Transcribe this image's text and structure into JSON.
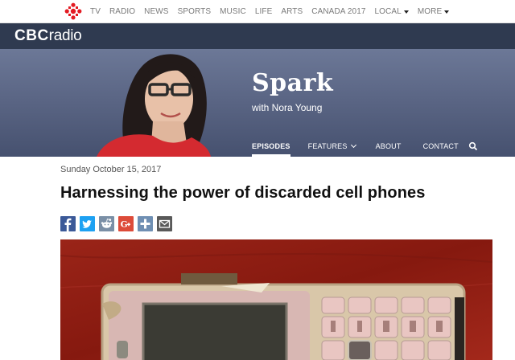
{
  "topnav": {
    "links": [
      {
        "label": "TV"
      },
      {
        "label": "RADIO"
      },
      {
        "label": "NEWS"
      },
      {
        "label": "SPORTS"
      },
      {
        "label": "MUSIC"
      },
      {
        "label": "LIFE"
      },
      {
        "label": "ARTS"
      },
      {
        "label": "CANADA 2017"
      },
      {
        "label": "LOCAL"
      },
      {
        "label": "MORE"
      }
    ],
    "logo_icon": "cbc-gem-icon",
    "dropdown_icon": "caret-down-icon"
  },
  "radiobar": {
    "brand_cbc": "CBC",
    "brand_radio": "radio"
  },
  "show": {
    "title": "Spark",
    "subtitle": "with Nora Young",
    "nav": [
      {
        "label": "EPISODES",
        "active": true
      },
      {
        "label": "FEATURES"
      },
      {
        "label": "ABOUT"
      },
      {
        "label": "CONTACT"
      }
    ],
    "search_icon": "search-icon"
  },
  "article": {
    "date": "Sunday October 15, 2017",
    "headline": "Harnessing the power of discarded cell phones",
    "share": [
      {
        "icon": "facebook-icon",
        "color": "#3b5998"
      },
      {
        "icon": "twitter-icon",
        "color": "#1da1f2"
      },
      {
        "icon": "reddit-icon",
        "color": "#7a8fa6"
      },
      {
        "icon": "google-plus-icon",
        "color": "#dd4b39"
      },
      {
        "icon": "add-share-icon",
        "color": "#6f8fb3"
      },
      {
        "icon": "email-icon",
        "color": "#595959"
      }
    ]
  },
  "colors": {
    "radio_bar": "#2f3a50",
    "banner": "#5b6685",
    "cbc_red": "#e31b23"
  }
}
